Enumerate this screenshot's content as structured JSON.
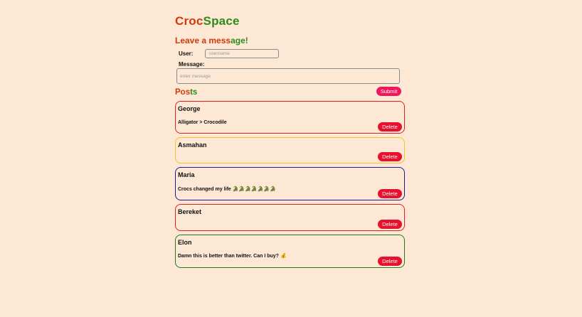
{
  "brand": {
    "part1": "Croc",
    "part2": "Space"
  },
  "form": {
    "heading_red": "Leave a mess",
    "heading_green": "age!",
    "user_label": "User:",
    "user_placeholder": "username",
    "message_label": "Message:",
    "message_placeholder": "enter message",
    "submit_label": "Submit"
  },
  "posts_heading": {
    "part1": "Pos",
    "part2": "ts"
  },
  "posts": [
    {
      "user": "George",
      "text": "Alligator > Crocodile",
      "emoji": "",
      "border_color": "#e02020",
      "delete_label": "Delete"
    },
    {
      "user": "Asmahan",
      "text": "",
      "emoji": "",
      "border_color": "#f2c627",
      "delete_label": "Delete"
    },
    {
      "user": "Maria",
      "text": "Crocs changed my life",
      "emoji": "🐊🐊🐊🐊🐊🐊🐊",
      "border_color": "#1c1a8a",
      "delete_label": "Delete"
    },
    {
      "user": "Bereket",
      "text": "",
      "emoji": "",
      "border_color": "#e02020",
      "delete_label": "Delete"
    },
    {
      "user": "Elon",
      "text": "Damn this is better than twitter. Can I buy?",
      "emoji": "💰",
      "border_color": "#1f7a1f",
      "delete_label": "Delete"
    }
  ],
  "colors": {
    "background": "#fce8d5",
    "brand_red": "#d4380d",
    "brand_green": "#2e8b1a",
    "submit_button": "#f0185c",
    "delete_button": "#e8112d"
  }
}
